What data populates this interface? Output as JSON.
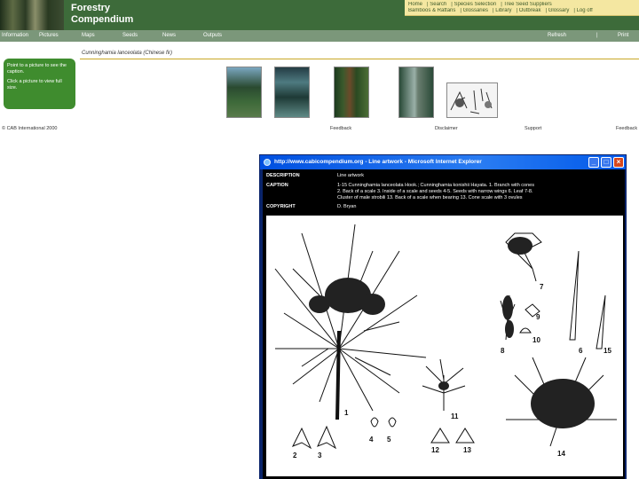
{
  "header": {
    "logo_line1": "Forestry",
    "logo_line2": "Compendium",
    "toplinks_row1": [
      "Home",
      "Search",
      "Species Selection",
      "Tree Seed Suppliers"
    ],
    "toplinks_row2": [
      "Bamboos & Rattans",
      "Glossaries",
      "Library",
      "Outbreak",
      "Glossary",
      "Log off"
    ]
  },
  "nav": {
    "items": [
      "Information",
      "Pictures",
      "Maps",
      "Seeds",
      "News",
      "Outputs"
    ],
    "right": [
      "Refresh",
      "Print"
    ]
  },
  "species_title": "Cunninghamia lanceolata (Chinese fir)",
  "sidebar": {
    "line1": "Point to a picture to see the caption.",
    "line2": "Click a picture to view full size."
  },
  "thumbnails": [
    "tree photo",
    "forest photo",
    "plantation photo",
    "trunk photo",
    "line artwork"
  ],
  "footer": {
    "copyright": "© CAB International 2000",
    "links": [
      "Feedback",
      "Disclaimer",
      "Support",
      "Feedback"
    ]
  },
  "popup": {
    "title": "http://www.cabicompendium.org - Line artwork - Microsoft Internet Explorer",
    "labels": {
      "description": "DESCRIPTION",
      "caption": "CAPTION",
      "copyright": "COPYRIGHT"
    },
    "description": "Line artwork",
    "caption_line1": "1-15 Cunninghamia lanceolata Hook.; Cunninghamia konishii Hayata. 1. Branch with cones",
    "caption_line2": "2. Back of a scale 3. Inside of a scale and seeds 4-5. Seeds with narrow wings 6. Leaf 7-8.",
    "caption_line3": "Cluster of male strobili 13. Back of a scale when bearing 13. Cone scale with 3 ovules",
    "copyright": "D. Bryan",
    "figure_numbers": [
      "1",
      "2",
      "3",
      "4",
      "5",
      "6",
      "7",
      "8",
      "9",
      "10",
      "11",
      "12",
      "13",
      "14",
      "15"
    ]
  }
}
